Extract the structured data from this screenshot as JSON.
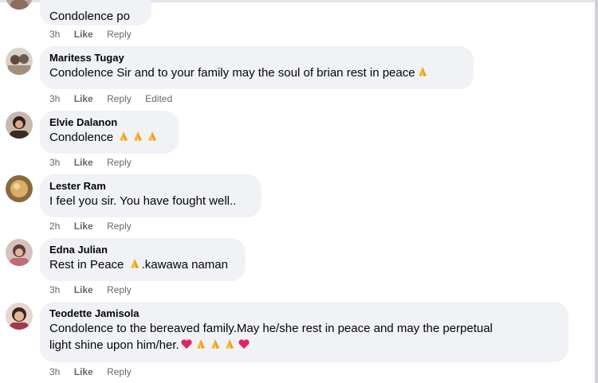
{
  "comments": [
    {
      "name": "",
      "text": "Condolence po",
      "emoji_after": [],
      "time": "3h",
      "like": "Like",
      "reply": "Reply",
      "edited": ""
    },
    {
      "name": "Maritess Tugay",
      "text": "Condolence Sir and to your family may the soul of brian rest in peace",
      "emoji_after": [
        "pray"
      ],
      "time": "3h",
      "like": "Like",
      "reply": "Reply",
      "edited": "Edited"
    },
    {
      "name": "Elvie Dalanon",
      "text": "Condolence ",
      "emoji_after": [
        "pray",
        "pray",
        "pray"
      ],
      "time": "3h",
      "like": "Like",
      "reply": "Reply",
      "edited": ""
    },
    {
      "name": "Lester Ram",
      "text": "I feel you sir. You have fought well..",
      "emoji_after": [],
      "time": "2h",
      "like": "Like",
      "reply": "Reply",
      "edited": ""
    },
    {
      "name": "Edna Julian",
      "text_before": "Rest in Peace ",
      "text_after": ".kawawa naman",
      "emoji_mid": [
        "pray"
      ],
      "time": "3h",
      "like": "Like",
      "reply": "Reply",
      "edited": ""
    },
    {
      "name": "Teodette Jamisola",
      "text": "Condolence to the bereaved family.May he/she rest in peace and may the perpetual",
      "text_line2": "light shine upon him/her.",
      "emoji_after": [
        "heart",
        "pray",
        "pray",
        "pray",
        "heart"
      ],
      "time": "3h",
      "like": "Like",
      "reply": "Reply",
      "edited": ""
    }
  ],
  "icons": {
    "pray": "folded-hands-emoji",
    "heart": "red-heart-emoji"
  },
  "colors": {
    "bubble": "#f0f2f5",
    "meta_text": "#65676b",
    "heart": "#e0245e",
    "pray": "#f5b52e"
  }
}
